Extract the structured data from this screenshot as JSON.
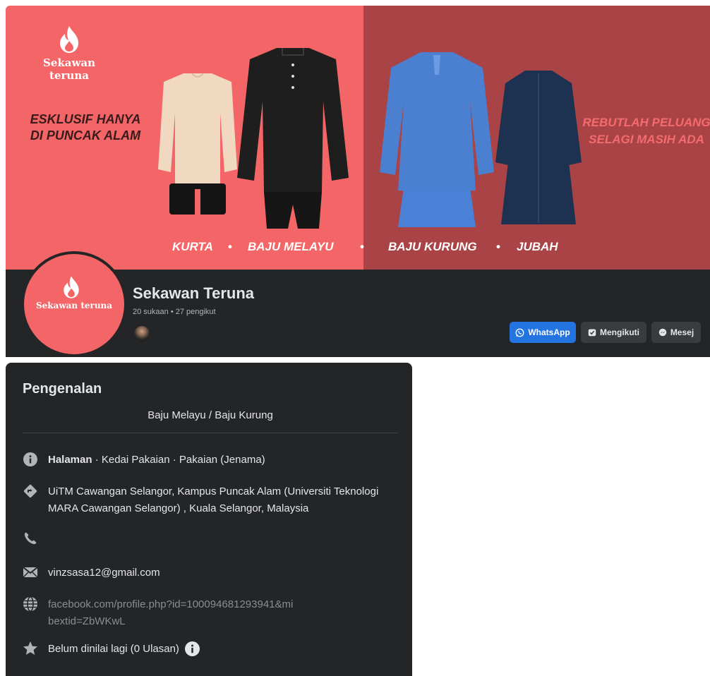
{
  "cover": {
    "brand_name": "Sekawan teruna",
    "tagline_left_line1": "ESKLUSIF HANYA",
    "tagline_left_line2": "DI PUNCAK ALAM",
    "tagline_right_line1": "REBUTLAH PELUANG",
    "tagline_right_line2": "SELAGI MASIH ADA",
    "categories": [
      "KURTA",
      "BAJU MELAYU",
      "BAJU KURUNG",
      "JUBAH"
    ],
    "separator": "•",
    "colors": {
      "left": "#f36566",
      "right": "#a94346"
    }
  },
  "profile": {
    "avatar_text": "Sekawan teruna",
    "name": "Sekawan Teruna",
    "stats": "20 sukaan • 27 pengikut",
    "buttons": {
      "whatsapp": "WhatsApp",
      "following": "Mengikuti",
      "message": "Mesej"
    },
    "accent": "#2374e1"
  },
  "intro": {
    "title": "Pengenalan",
    "bio": "Baju Melayu / Baju Kurung",
    "category_strong": "Halaman",
    "category_rest": " · Kedai Pakaian · Pakaian (Jenama)",
    "address": "UiTM Cawangan Selangor, Kampus Puncak Alam (Universiti Teknologi MARA Cawangan Selangor) , Kuala Selangor, Malaysia",
    "phone": "",
    "email": "vinzsasa12@gmail.com",
    "website": "facebook.com/profile.php?id=100094681293941&mibextid=ZbWKwL",
    "rating": "Belum dinilai lagi (0 Ulasan)",
    "icons": [
      "info-icon",
      "location-icon",
      "phone-icon",
      "email-icon",
      "globe-icon",
      "star-icon"
    ]
  }
}
